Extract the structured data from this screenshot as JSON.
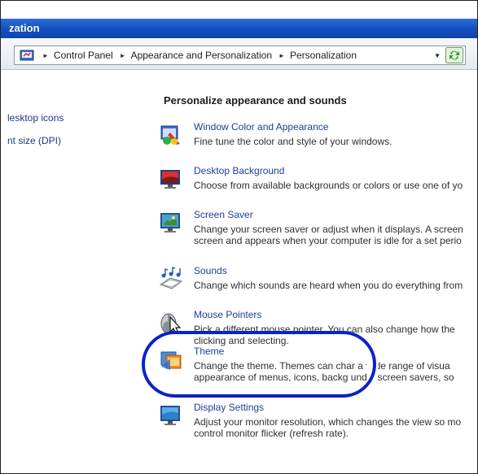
{
  "window": {
    "title_fragment": "zation"
  },
  "address_bar": {
    "crumbs": [
      "Control Panel",
      "Appearance and Personalization",
      "Personalization"
    ]
  },
  "left_pane": {
    "links": [
      "lesktop icons",
      "nt size (DPI)"
    ]
  },
  "main": {
    "heading": "Personalize appearance and sounds",
    "items": [
      {
        "icon": "window-color-icon",
        "title": "Window Color and Appearance",
        "desc": "Fine tune the color and style of your windows."
      },
      {
        "icon": "desktop-background-icon",
        "title": "Desktop Background",
        "desc": "Choose from available backgrounds or colors or use one of yo"
      },
      {
        "icon": "screen-saver-icon",
        "title": "Screen Saver",
        "desc": "Change your screen saver or adjust when it displays. A screen\nscreen and appears when your computer is idle for a set perio"
      },
      {
        "icon": "sounds-icon",
        "title": "Sounds",
        "desc": "Change which sounds are heard when you do everything from"
      },
      {
        "icon": "mouse-pointer-icon",
        "title": "Mouse Pointers",
        "desc": "Pick a different mouse pointer. You can also change how the\nclicking and selecting."
      },
      {
        "icon": "theme-icon",
        "title": "Theme",
        "desc": "Change the theme. Themes can char  a wide range of visua\nappearance of menus, icons, backg   unds, screen savers, so"
      },
      {
        "icon": "display-settings-icon",
        "title": "Display Settings",
        "desc": "Adjust your monitor resolution, which changes the view so mo\ncontrol monitor flicker (refresh rate)."
      }
    ]
  },
  "colors": {
    "titlebar": "#1652c4",
    "link": "#1a3f98",
    "highlight": "#0b22c8"
  }
}
